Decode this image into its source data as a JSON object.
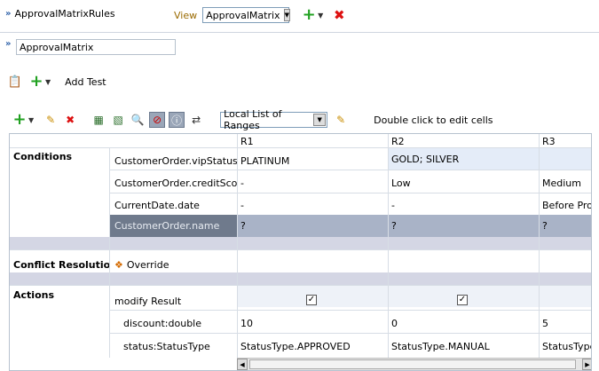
{
  "header": {
    "title": "ApprovalMatrixRules",
    "view_label": "View",
    "view_value": "ApprovalMatrix"
  },
  "name_field": {
    "value": "ApprovalMatrix"
  },
  "test_toolbar": {
    "add_test_label": "Add Test"
  },
  "grid_toolbar": {
    "list_value": "Local List of Ranges",
    "hint": "Double click to edit cells"
  },
  "grid": {
    "columns": [
      "R1",
      "R2",
      "R3"
    ],
    "conditions_label": "Conditions",
    "conditions": [
      {
        "name": "CustomerOrder.vipStatus",
        "values": [
          "PLATINUM",
          "GOLD; SILVER",
          ""
        ]
      },
      {
        "name": "CustomerOrder.creditScore",
        "values": [
          "-",
          "Low",
          "Medium"
        ]
      },
      {
        "name": "CurrentDate.date",
        "values": [
          "-",
          "-",
          "Before Prom"
        ]
      },
      {
        "name": "CustomerOrder.name",
        "values": [
          "?",
          "?",
          "?"
        ]
      }
    ],
    "conflict_label": "Conflict Resolution",
    "conflict_value": "Override",
    "actions_label": "Actions",
    "actions": [
      {
        "name": "modify Result",
        "checks": [
          true,
          true,
          false
        ]
      },
      {
        "name": "discount:double",
        "values": [
          "10",
          "0",
          "5"
        ]
      },
      {
        "name": "status:StatusType",
        "values": [
          "StatusType.APPROVED",
          "StatusType.MANUAL",
          "StatusType."
        ]
      }
    ]
  },
  "colors": {
    "selected_row": "#a9b3c7",
    "selected_header": "#6f7a8c",
    "highlight_cell": "#e4ecf8",
    "band": "#d4d6e4"
  }
}
